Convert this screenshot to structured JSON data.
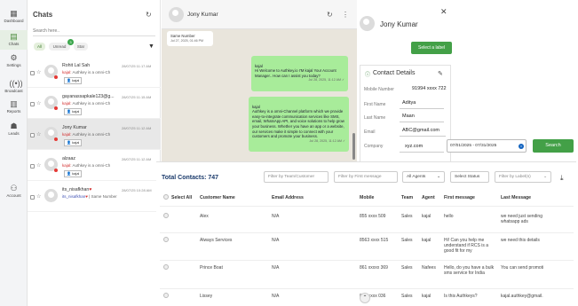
{
  "nav": {
    "items": [
      {
        "label": "Dashboard",
        "icon": "dashboard-icon"
      },
      {
        "label": "Chats",
        "icon": "chat-icon"
      },
      {
        "label": "Settings",
        "icon": "settings-icon"
      },
      {
        "label": "Broadcast",
        "icon": "broadcast-icon"
      },
      {
        "label": "Reports",
        "icon": "reports-icon"
      },
      {
        "label": "Leads",
        "icon": "leads-icon"
      },
      {
        "label": "Account",
        "icon": "account-icon"
      }
    ]
  },
  "chats": {
    "title": "Chats",
    "search_placeholder": "Search here..",
    "filters": {
      "all": "All",
      "unread": "Unread",
      "unread_count": "3",
      "star": "Star"
    },
    "items": [
      {
        "name": "Rohit Lal Sah",
        "time": "28/07/25 11:17 AM",
        "preview_prefix": "kajal:",
        "preview": "Authkey is a omni-Ch",
        "tag": "kajal"
      },
      {
        "name": "gayanassapkale123@g...",
        "time": "28/07/25 11:15 AM",
        "preview_prefix": "kajal:",
        "preview": "Authkey is a omni-Ch",
        "tag": "kajal"
      },
      {
        "name": "Jony Kumar",
        "time": "28/07/25 11:12 AM",
        "preview_prefix": "kajal:",
        "preview": "Authkey is a omni-Ch",
        "tag": "kajal"
      },
      {
        "name": "alzaaz",
        "time": "28/07/25 11:12 AM",
        "preview_prefix": "kajal:",
        "preview": "Authkey is a omni-Ch",
        "tag": "kajal"
      },
      {
        "name": "its_nisafkhan",
        "time": "28/07/25 10:28 AM",
        "preview_prefix": "its_nisafkhan",
        "preview": "| Same Number",
        "tag": ""
      }
    ]
  },
  "chat": {
    "contact_name": "Jony Kumar",
    "messages": [
      {
        "dir": "in",
        "text": "Same Number",
        "time": "Jul 27, 2025, 01:46 PM"
      },
      {
        "dir": "out",
        "text": "kajal\nHi Welcome to Authkey.io I'M kajal Your Account Manager.. How can I assist you today?",
        "time": "Jul 28, 2025, 11:12 AM ✓"
      },
      {
        "dir": "out",
        "text": "kajal\nAuthkey is a omni-Channel platform which we provide easy-to-integrate communication services like SMS, email, WhatsApp API, and voice solutions to help grow your business. Whether you have an app or a website, our services make it simple to connect with your customers and promote your business.",
        "time": "Jul 28, 2025, 11:12 AM ✓"
      }
    ]
  },
  "contact": {
    "name": "Jony Kumar",
    "select_label": "Select a label",
    "section_title": "Contact Details",
    "fields": [
      {
        "label": "Mobile Number",
        "value": "91994 xxxx 722"
      },
      {
        "label": "First Name",
        "value": "Aditya"
      },
      {
        "label": "Last Name",
        "value": "Maan"
      },
      {
        "label": "Email",
        "value": "ABC@gmail.com"
      },
      {
        "label": "Company",
        "value": "xyz.com"
      }
    ]
  },
  "contacts": {
    "total_label": "Total Contacts: 747",
    "date_range": "07/01/2025 - 07/31/2025",
    "search_button": "Search",
    "filters": {
      "team_customer": "Filter by Team/Customer",
      "first_message": "Filter by First message",
      "agents": "All Agents",
      "status": "Select Status",
      "labels": "Filter by Label(s)"
    },
    "columns": [
      "Select All",
      "Customer Name",
      "Email Address",
      "Mobile",
      "Team",
      "Agent",
      "First message",
      "Last Message"
    ],
    "rows": [
      {
        "name": "Alex",
        "email": "N/A",
        "mobile": "855 xxxx 509",
        "team": "Sales",
        "agent": "kajal",
        "first": "hello",
        "last": "we need just sending whatsapp ads"
      },
      {
        "name": "Always Services",
        "email": "N/A",
        "mobile": "8563 xxxx 515",
        "team": "Sales",
        "agent": "kajal",
        "first": "Hi! Can you help me understand if RCS is a good fit for my",
        "last": "we need this details"
      },
      {
        "name": "Prince Boat",
        "email": "N/A",
        "mobile": "861 xxxxx 369",
        "team": "Sales",
        "agent": "Nafees",
        "first": "Hello, do you have a bulk sms service for India",
        "last": "You can send promoti"
      },
      {
        "name": "Lissey",
        "email": "N/A",
        "mobile": "852 xxxx 036",
        "team": "Sales",
        "agent": "kajal",
        "first": "Is this Authkeys?",
        "last": "kajal.authkey@gmail."
      }
    ]
  }
}
